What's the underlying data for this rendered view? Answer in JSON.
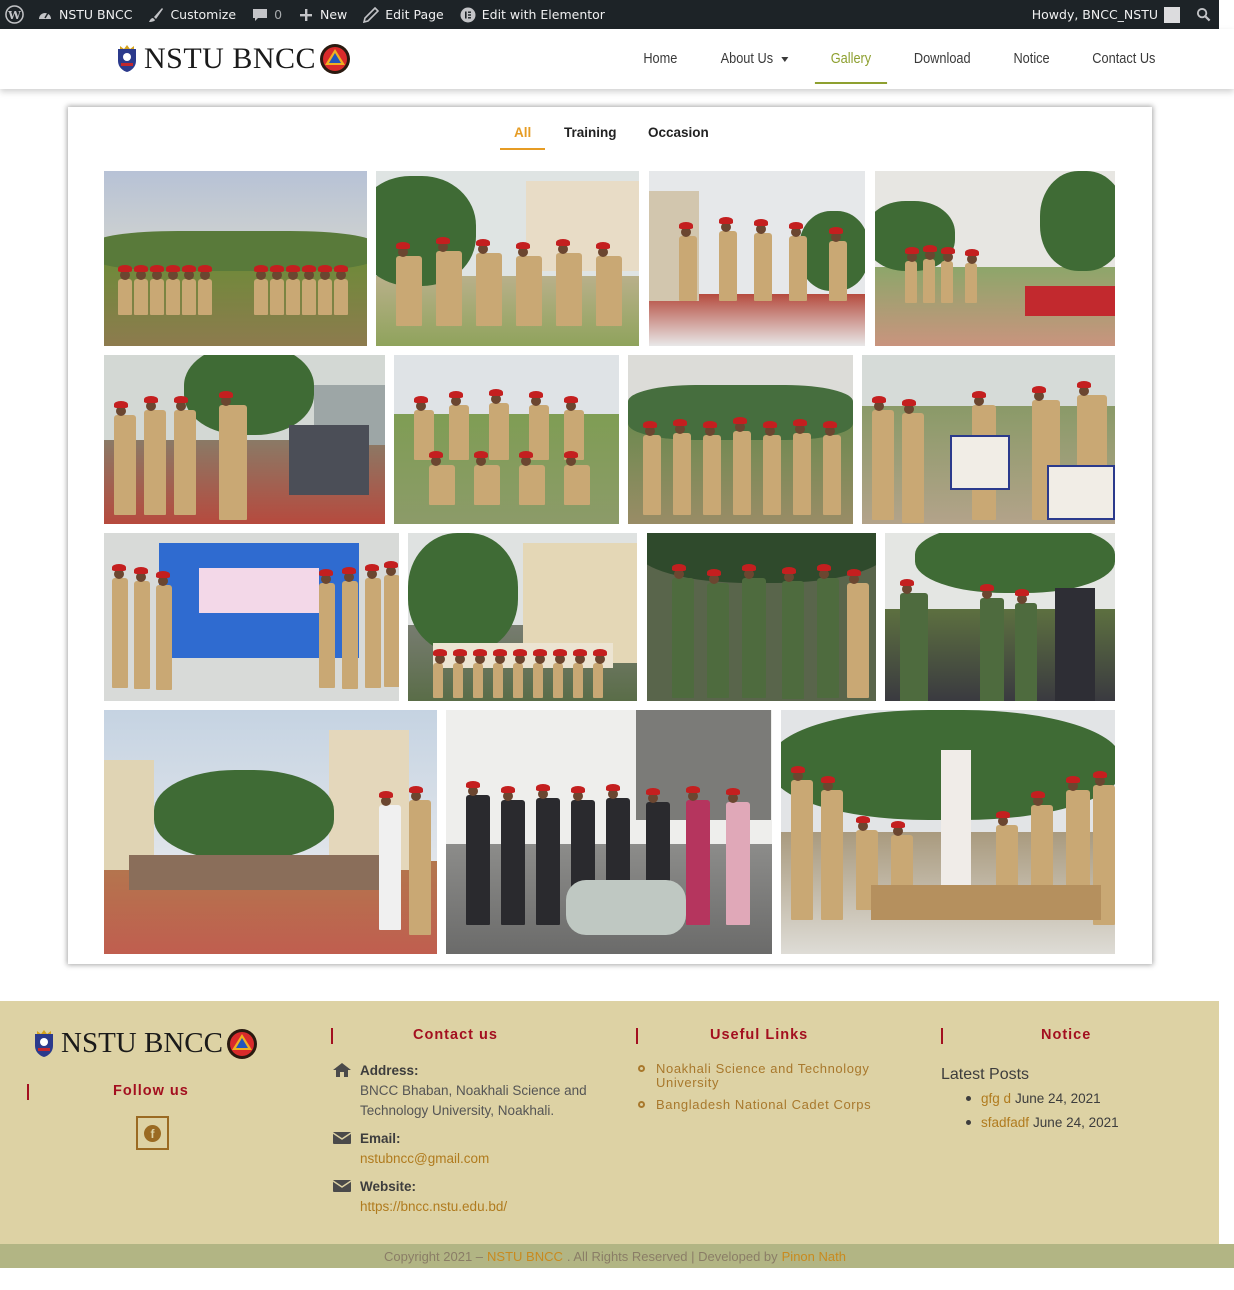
{
  "adminbar": {
    "site_name": "NSTU BNCC",
    "customize": "Customize",
    "comments_count": "0",
    "new": "New",
    "edit_page": "Edit Page",
    "edit_elementor": "Edit with Elementor",
    "howdy": "Howdy, BNCC_NSTU",
    "icons": [
      "wordpress-icon",
      "dashboard-icon",
      "brush-icon",
      "comment-icon",
      "plus-icon",
      "pencil-icon",
      "elementor-icon",
      "search-icon"
    ]
  },
  "header": {
    "logo_text": "NSTU BNCC",
    "nav": [
      {
        "label": "Home"
      },
      {
        "label": "About Us"
      },
      {
        "label": "Gallery"
      },
      {
        "label": "Download"
      },
      {
        "label": "Notice"
      },
      {
        "label": "Contact Us"
      }
    ],
    "active_nav": "Gallery",
    "accent": "#8ea030"
  },
  "gallery": {
    "filters": [
      "All",
      "Training",
      "Occasion"
    ],
    "active_filter": "All",
    "filter_accent": "#e69c24",
    "photo_count": 15
  },
  "footer": {
    "logo_text": "NSTU BNCC",
    "follow_heading": "Follow us",
    "contact_heading": "Contact us",
    "address_label": "Address:",
    "address_line1": "BNCC Bhaban, Noakhali Science and",
    "address_line2": "Technology University, Noakhali.",
    "email_label": "Email:",
    "email": "nstubncc@gmail.com",
    "website_label": "Website:",
    "website": "https://bncc.nstu.edu.bd/",
    "links_heading": "Useful Links",
    "links": [
      {
        "line1": "Noakhali Science and Technology",
        "line2": "University"
      },
      {
        "line1": "Bangladesh National Cadet Corps",
        "line2": ""
      }
    ],
    "notice_heading": "Notice",
    "latest_posts": "Latest Posts",
    "posts": [
      {
        "title": "gfg d",
        "date": "June 24, 2021"
      },
      {
        "title": "sfadfadf",
        "date": "June 24, 2021"
      }
    ],
    "bg": "#ddd2a4",
    "heading_color": "#a30f1f"
  },
  "copyright": {
    "prefix": "Copyright 2021 –",
    "site": "NSTU BNCC",
    "middle": ". All Rights Reserved | Developed by",
    "developer": "Pinon Nath"
  }
}
